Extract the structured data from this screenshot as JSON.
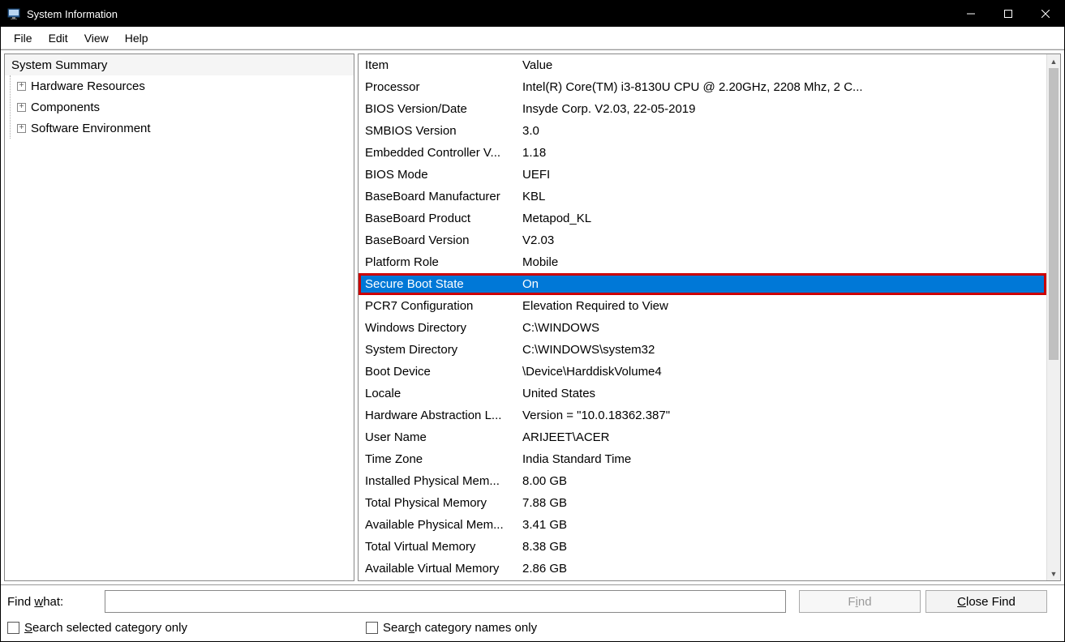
{
  "window": {
    "title": "System Information"
  },
  "menubar": {
    "items": [
      "File",
      "Edit",
      "View",
      "Help"
    ]
  },
  "tree": {
    "root": "System Summary",
    "children": [
      "Hardware Resources",
      "Components",
      "Software Environment"
    ]
  },
  "list": {
    "headers": {
      "item": "Item",
      "value": "Value"
    },
    "rows": [
      {
        "item": "Processor",
        "value": "Intel(R) Core(TM) i3-8130U CPU @ 2.20GHz, 2208 Mhz, 2 C...",
        "selected": false
      },
      {
        "item": "BIOS Version/Date",
        "value": "Insyde Corp. V2.03, 22-05-2019",
        "selected": false
      },
      {
        "item": "SMBIOS Version",
        "value": "3.0",
        "selected": false
      },
      {
        "item": "Embedded Controller V...",
        "value": "1.18",
        "selected": false
      },
      {
        "item": "BIOS Mode",
        "value": "UEFI",
        "selected": false
      },
      {
        "item": "BaseBoard Manufacturer",
        "value": "KBL",
        "selected": false
      },
      {
        "item": "BaseBoard Product",
        "value": "Metapod_KL",
        "selected": false
      },
      {
        "item": "BaseBoard Version",
        "value": "V2.03",
        "selected": false
      },
      {
        "item": "Platform Role",
        "value": "Mobile",
        "selected": false
      },
      {
        "item": "Secure Boot State",
        "value": "On",
        "selected": true
      },
      {
        "item": "PCR7 Configuration",
        "value": "Elevation Required to View",
        "selected": false
      },
      {
        "item": "Windows Directory",
        "value": "C:\\WINDOWS",
        "selected": false
      },
      {
        "item": "System Directory",
        "value": "C:\\WINDOWS\\system32",
        "selected": false
      },
      {
        "item": "Boot Device",
        "value": "\\Device\\HarddiskVolume4",
        "selected": false
      },
      {
        "item": "Locale",
        "value": "United States",
        "selected": false
      },
      {
        "item": "Hardware Abstraction L...",
        "value": "Version = \"10.0.18362.387\"",
        "selected": false
      },
      {
        "item": "User Name",
        "value": "ARIJEET\\ACER",
        "selected": false
      },
      {
        "item": "Time Zone",
        "value": "India Standard Time",
        "selected": false
      },
      {
        "item": "Installed Physical Mem...",
        "value": "8.00 GB",
        "selected": false
      },
      {
        "item": "Total Physical Memory",
        "value": "7.88 GB",
        "selected": false
      },
      {
        "item": "Available Physical Mem...",
        "value": "3.41 GB",
        "selected": false
      },
      {
        "item": "Total Virtual Memory",
        "value": "8.38 GB",
        "selected": false
      },
      {
        "item": "Available Virtual Memory",
        "value": "2.86 GB",
        "selected": false
      }
    ]
  },
  "find": {
    "label_html": "Find <u>w</u>hat:",
    "input_value": "",
    "find_btn_html": "F<u>i</u>nd",
    "close_btn_html": "<u>C</u>lose Find",
    "chk1_html": "<u>S</u>earch selected category only",
    "chk2_html": "Sear<u>c</u>h category names only",
    "chk1_checked": false,
    "chk2_checked": false
  }
}
